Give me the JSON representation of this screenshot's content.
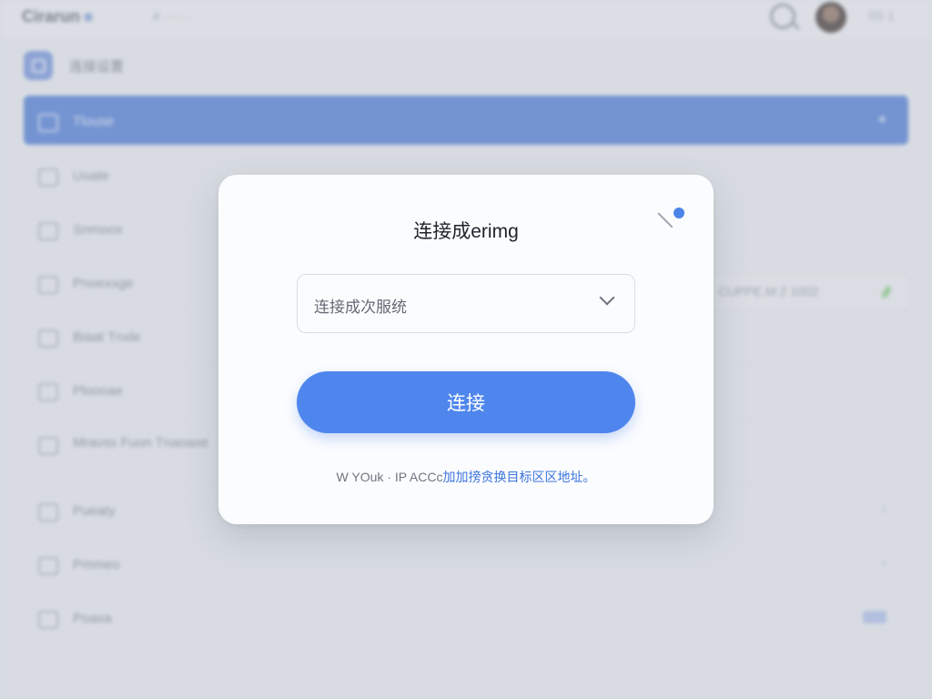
{
  "topbar": {
    "logo": "Cirarun",
    "breadcrumb": "# ····· ·",
    "user": "0S 1"
  },
  "app": {
    "title": "连接设置"
  },
  "sidebar": {
    "items": [
      {
        "label": "Tlouse",
        "selected": true,
        "trailing": "+"
      },
      {
        "label": "Uoate"
      },
      {
        "label": "Snmoox"
      },
      {
        "label": "Pnoexxge"
      },
      {
        "label": "Biaat Tnxle"
      },
      {
        "label": "Ploooae"
      },
      {
        "label": "Mravss Fuon Tnaoaxe"
      },
      {
        "label": "Pueaty",
        "trailing": "›"
      },
      {
        "label": "Pmmeo",
        "trailing": "›"
      },
      {
        "label": "Poaxa"
      }
    ]
  },
  "status_box": {
    "text": "CUPPE.M 2 1002"
  },
  "dialog": {
    "title": "连接成erimg",
    "select_value": "连接成次服统",
    "connect_label": "连接",
    "footer_text": "W YOuk · IP ACCc",
    "footer_link": "加加搒贪换目标区区地址。"
  },
  "colors": {
    "accent": "#4f86ed",
    "selected_row": "#4a78d2",
    "link": "#3b74dd",
    "status_ok": "#7ec77b"
  }
}
